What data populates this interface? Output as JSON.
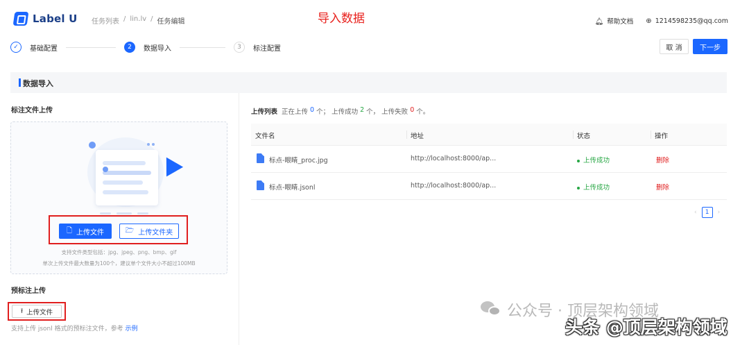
{
  "app": {
    "logo_text": "Label U"
  },
  "breadcrumb": {
    "items": [
      "任务列表",
      "/",
      "lin.lv",
      "/"
    ],
    "current": "任务编辑"
  },
  "overlay_title": "导入数据",
  "topright": {
    "help": "帮助文档",
    "user": "1214598235@qq.com"
  },
  "steps": [
    {
      "index": "✓",
      "label": "基础配置",
      "state": "done"
    },
    {
      "index": "2",
      "label": "数据导入",
      "state": "active"
    },
    {
      "index": "3",
      "label": "标注配置",
      "state": "idle"
    }
  ],
  "actions": {
    "cancel": "取 消",
    "next": "下一步"
  },
  "section": {
    "title": "数据导入"
  },
  "upload_panel": {
    "title": "标注文件上传",
    "upload_file": "上传文件",
    "upload_folder": "上传文件夹",
    "hint_types": "支持文件类型包括：jpg、jpeg、png、bmp、gif",
    "hint_limit": "单次上传文件最大数量为100个，建议单个文件大小不超过100MB"
  },
  "pre_annotation": {
    "title": "预标注上传",
    "upload_button": "上传文件",
    "hint_prefix": "支持上传 jsonl 格式的预标注文件，参考",
    "hint_link": "示例"
  },
  "upload_list": {
    "label": "上传列表",
    "uploading_prefix": "正在上传",
    "uploading_count": "0",
    "uploading_suffix": "个；",
    "success_prefix": "上传成功",
    "success_count": "2",
    "success_suffix": "个，",
    "failed_prefix": "上传失败",
    "failed_count": "0",
    "failed_suffix": "个。"
  },
  "table": {
    "columns": [
      "文件名",
      "地址",
      "状态",
      "操作"
    ],
    "rows": [
      {
        "name": "标点-眼睛_proc.jpg",
        "url": "http://localhost:8000/ap...",
        "status": "上传成功",
        "action": "删除"
      },
      {
        "name": "标点-眼睛.jsonl",
        "url": "http://localhost:8000/ap...",
        "status": "上传成功",
        "action": "删除"
      }
    ]
  },
  "pagination": {
    "prev": "‹",
    "page": "1",
    "next": "›"
  },
  "watermarks": {
    "wechat": "公众号 · 顶层架构领域",
    "toutiao": "头条 @顶层架构领域"
  },
  "colors": {
    "primary": "#1b67ff",
    "success": "#28a745",
    "danger": "#e01e1e",
    "annotation_red": "#e01e1e"
  }
}
